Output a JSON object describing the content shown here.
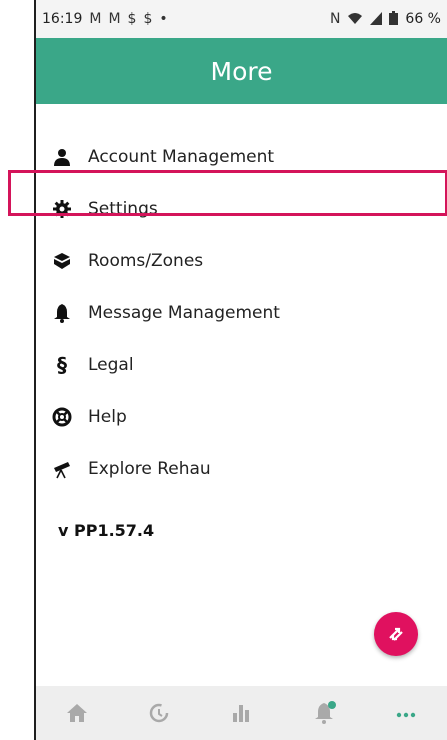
{
  "status_bar": {
    "time": "16:19",
    "left_icons": [
      "M",
      "M",
      "$",
      "$",
      "•"
    ],
    "right_icons": [
      "N",
      "wifi",
      "signal",
      "battery"
    ],
    "battery": "66 %"
  },
  "header": {
    "title": "More"
  },
  "menu": {
    "items": [
      {
        "label": "Account Management",
        "icon": "user-icon"
      },
      {
        "label": "Settings",
        "icon": "gear-icon"
      },
      {
        "label": "Rooms/Zones",
        "icon": "cube-icon"
      },
      {
        "label": "Message Management",
        "icon": "bell-icon"
      },
      {
        "label": "Legal",
        "icon": "section-icon"
      },
      {
        "label": "Help",
        "icon": "lifebuoy-icon"
      },
      {
        "label": "Explore Rehau",
        "icon": "telescope-icon"
      }
    ]
  },
  "version": "v PP1.57.4",
  "bottom_nav": {
    "items": [
      "home-icon",
      "clock-icon",
      "bar-chart-icon",
      "bell-icon",
      "more-icon"
    ]
  },
  "colors": {
    "accent": "#3aa788",
    "fab": "#e0115f",
    "highlight": "#d4145a"
  },
  "highlight_target": "Settings"
}
